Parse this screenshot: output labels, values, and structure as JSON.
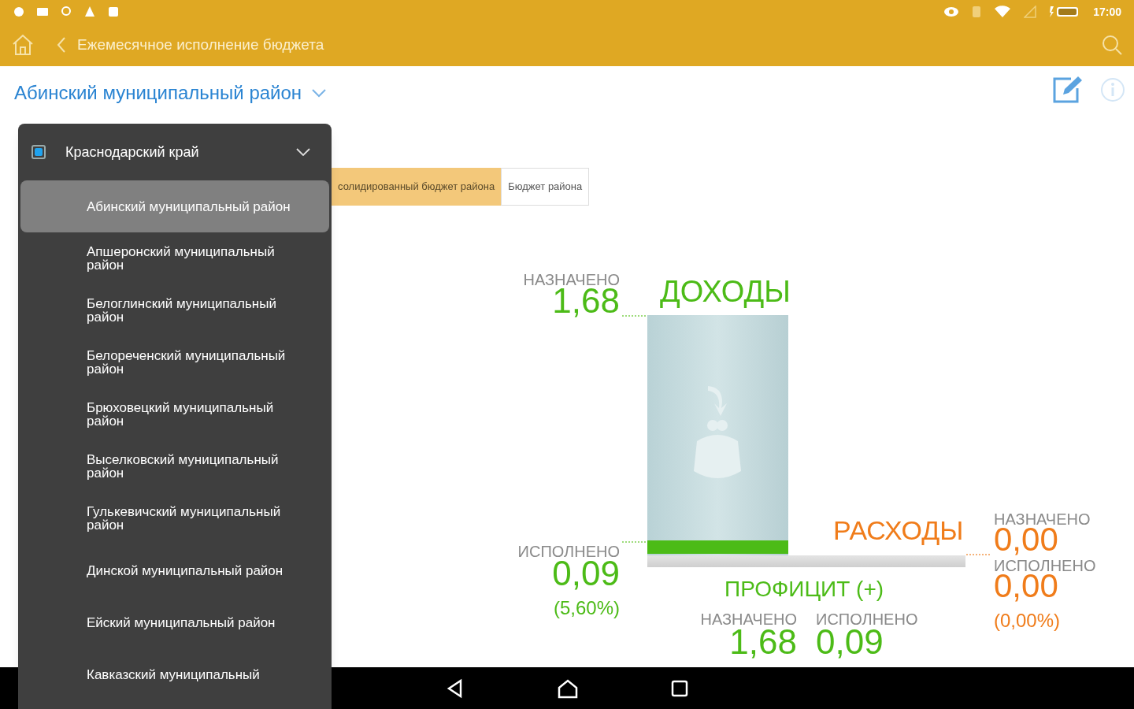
{
  "status_bar": {
    "time": "17:00"
  },
  "toolbar": {
    "title": "Ежемесячное исполнение бюджета"
  },
  "region_selector": {
    "label": "Абинский муниципальный район"
  },
  "budget_tabs": [
    {
      "label": "солидированный бюджет района",
      "selected": true
    },
    {
      "label": "Бюджет района",
      "selected": false
    }
  ],
  "region_dropdown": {
    "header": {
      "label": "Краснодарский край",
      "checked": true
    },
    "items": [
      {
        "label": "Абинский муниципальный район",
        "selected": true
      },
      {
        "label": "Апшеронский муниципальный район",
        "selected": false
      },
      {
        "label": "Белоглинский муниципальный район",
        "selected": false
      },
      {
        "label": "Белореченский муниципальный район",
        "selected": false
      },
      {
        "label": "Брюховецкий муниципальный район",
        "selected": false
      },
      {
        "label": "Выселковский муниципальный район",
        "selected": false
      },
      {
        "label": "Гулькевичский муниципальный район",
        "selected": false
      },
      {
        "label": "Динской муниципальный район",
        "selected": false
      },
      {
        "label": "Ейский муниципальный район",
        "selected": false
      },
      {
        "label": "Кавказский муниципальный",
        "selected": false
      }
    ]
  },
  "summary": {
    "income": {
      "title": "ДОХОДЫ",
      "planned_label": "НАЗНАЧЕНО",
      "planned": "1,68",
      "executed_label": "ИСПОЛНЕНО",
      "executed": "0,09",
      "percent": "(5,60%)",
      "level": 0.056
    },
    "expenses": {
      "title": "РАСХОДЫ",
      "planned_label": "НАЗНАЧЕНО",
      "planned": "0,00",
      "executed_label": "ИСПОЛНЕНО",
      "executed": "0,00",
      "percent": "(0,00%)"
    },
    "surplus": {
      "title": "ПРОФИЦИТ (+)",
      "planned_label": "НАЗНАЧЕНО",
      "planned": "1,68",
      "executed_label": "ИСПОЛНЕНО",
      "executed": "0,09"
    }
  }
}
